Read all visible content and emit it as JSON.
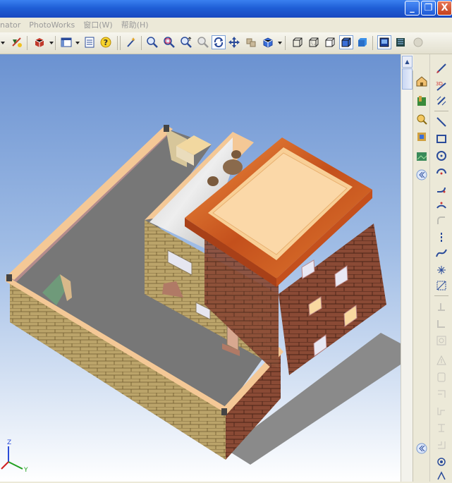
{
  "menu": {
    "items": [
      "nator",
      "PhotoWorks",
      "窗口(W)",
      "帮助(H)"
    ]
  },
  "window": {
    "minimize": "_",
    "restore": "❐",
    "close": "X"
  },
  "toolbar": {
    "icons": [
      "arrow-dropdown",
      "smart-dimension",
      "3d-part",
      "view-dropdown",
      "list",
      "help",
      "wand",
      "zoom-to-fit",
      "zoom-area",
      "zoom-in-out",
      "zoom-selection",
      "rotate-view",
      "pan-view",
      "previous-view",
      "standard-views",
      "wireframe",
      "hidden-lines",
      "hidden-removed",
      "shaded-edges",
      "shaded",
      "section",
      "rendered",
      "lights"
    ]
  },
  "scrollbar": {
    "up": "▲"
  },
  "axes": {
    "z": "Z",
    "y": "Y"
  },
  "colors": {
    "viewport_top": "#6b92d1",
    "viewport_bottom": "#ffffff",
    "brick_tan": "#bba46a",
    "brick_red": "#8a4a35",
    "roof_orange": "#d36a2a",
    "roof_top": "#f8cf96",
    "floor_gray": "#7e7e7e",
    "wall_inner_pink": "#b38c8c"
  }
}
